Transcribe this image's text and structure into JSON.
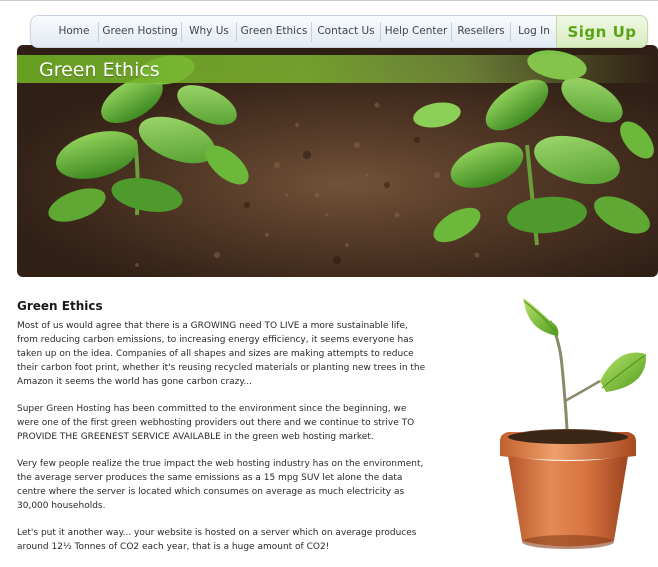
{
  "nav": {
    "items": [
      "Home",
      "Green Hosting",
      "Why Us",
      "Green Ethics",
      "Contact Us",
      "Help Center",
      "Resellers",
      "Log In"
    ],
    "signup": "Sign Up"
  },
  "hero": {
    "title": "Green Ethics"
  },
  "content": {
    "heading": "Green Ethics",
    "paragraphs": [
      "Most of us would agree that there is a GROWING need TO LIVE a more sustainable life, from reducing carbon emissions, to increasing energy efficiency, it seems everyone has taken up on the idea. Companies of all shapes and sizes are making attempts to reduce their carbon foot print, whether it's reusing recycled materials or planting new trees in the Amazon it seems the world has gone carbon crazy...",
      "Super Green Hosting has been committed to the environment since the beginning, we were one of the first green webhosting providers out there and we continue to strive TO PROVIDE THE GREENEST SERVICE AVAILABLE in the green web hosting market.",
      "Very few people realize the true impact the web hosting industry has on the environment, the average server produces the same emissions as a 15 mpg SUV let alone the data centre where the server is located which consumes on average as much electricity as 30,000 households.",
      "Let's put it another way... your website is hosted on a server which on average produces around 12½ Tonnes of CO2 each year, that is a huge amount of CO2!"
    ]
  },
  "colors": {
    "accent": "#6aaa23",
    "signup": "#5aa316"
  }
}
